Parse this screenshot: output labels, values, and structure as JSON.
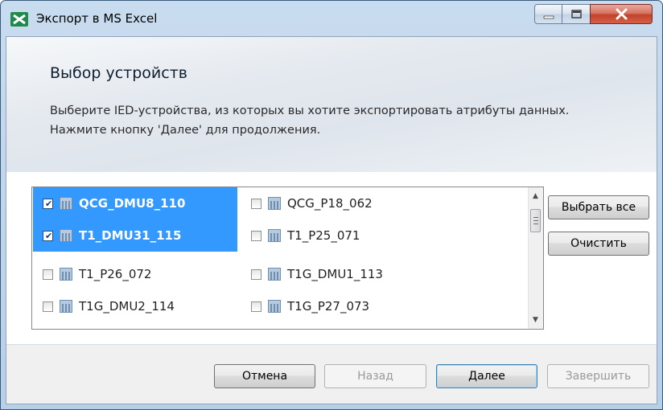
{
  "window": {
    "title": "Экспорт в MS Excel"
  },
  "header": {
    "title": "Выбор устройств",
    "line1": "Выберите IED-устройства, из которых вы хотите экспортировать атрибуты данных.",
    "line2": "Нажмите кнопку 'Далее' для продолжения."
  },
  "devices": [
    {
      "label": "QCG_DMU8_110",
      "checked": true,
      "selected": true
    },
    {
      "label": "QCG_P18_062",
      "checked": false,
      "selected": false
    },
    {
      "label": "T1_DMU31_115",
      "checked": true,
      "selected": true
    },
    {
      "label": "T1_P25_071",
      "checked": false,
      "selected": false
    },
    {
      "label": "T1_P26_072",
      "checked": false,
      "selected": false
    },
    {
      "label": "T1G_DMU1_113",
      "checked": false,
      "selected": false
    },
    {
      "label": "T1G_DMU2_114",
      "checked": false,
      "selected": false
    },
    {
      "label": "T1G_P27_073",
      "checked": false,
      "selected": false
    }
  ],
  "side_buttons": {
    "select_all": "Выбрать все",
    "clear": "Очистить"
  },
  "footer": {
    "cancel": "Отмена",
    "back": "Назад",
    "next": "Далее",
    "finish": "Завершить"
  },
  "icons": {
    "app": "excel-export-icon",
    "device": "ied-device-icon",
    "checkmark": "✔"
  },
  "colors": {
    "selection": "#3399ff",
    "title_bar": "#b7cfe8",
    "close_button": "#c2412b"
  }
}
